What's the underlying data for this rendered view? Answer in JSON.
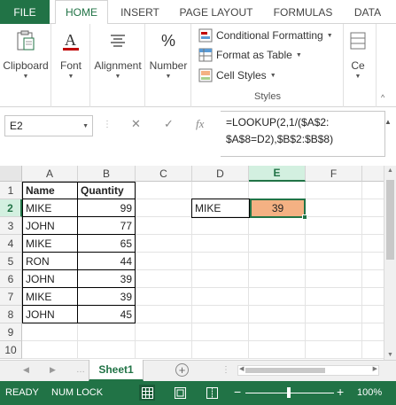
{
  "ribbon": {
    "tabs": [
      "FILE",
      "HOME",
      "INSERT",
      "PAGE LAYOUT",
      "FORMULAS",
      "DATA"
    ],
    "active_tab": "HOME",
    "groups": {
      "clipboard": "Clipboard",
      "font": "Font",
      "alignment": "Alignment",
      "number": "Number",
      "cells_partial": "Ce"
    },
    "styles": {
      "conditional_formatting": "Conditional Formatting",
      "format_as_table": "Format as Table",
      "cell_styles": "Cell Styles",
      "caption": "Styles"
    },
    "number_symbol": "%"
  },
  "formula_bar": {
    "name_box": "E2",
    "fx": "fx",
    "formula_line1": "=LOOKUP(2,1/($A$2:",
    "formula_line2": "$A$8=D2),$B$2:$B$8)"
  },
  "grid": {
    "columns": [
      "A",
      "B",
      "C",
      "D",
      "E",
      "F"
    ],
    "selected_column": "E",
    "rows": [
      "1",
      "2",
      "3",
      "4",
      "5",
      "6",
      "7",
      "8",
      "9",
      "10"
    ],
    "selected_row": "2",
    "table_header": {
      "name": "Name",
      "quantity": "Quantity"
    },
    "table": [
      {
        "name": "MIKE",
        "quantity": "99"
      },
      {
        "name": "JOHN",
        "quantity": "77"
      },
      {
        "name": "MIKE",
        "quantity": "65"
      },
      {
        "name": "RON",
        "quantity": "44"
      },
      {
        "name": "JOHN",
        "quantity": "39"
      },
      {
        "name": "MIKE",
        "quantity": "39"
      },
      {
        "name": "JOHN",
        "quantity": "45"
      }
    ],
    "lookup_name": "MIKE",
    "lookup_result": "39",
    "result_fill": "#f4b183"
  },
  "sheets": {
    "active": "Sheet1"
  },
  "status": {
    "ready": "READY",
    "num_lock": "NUM LOCK",
    "zoom": "100%",
    "accent": "#217346"
  }
}
